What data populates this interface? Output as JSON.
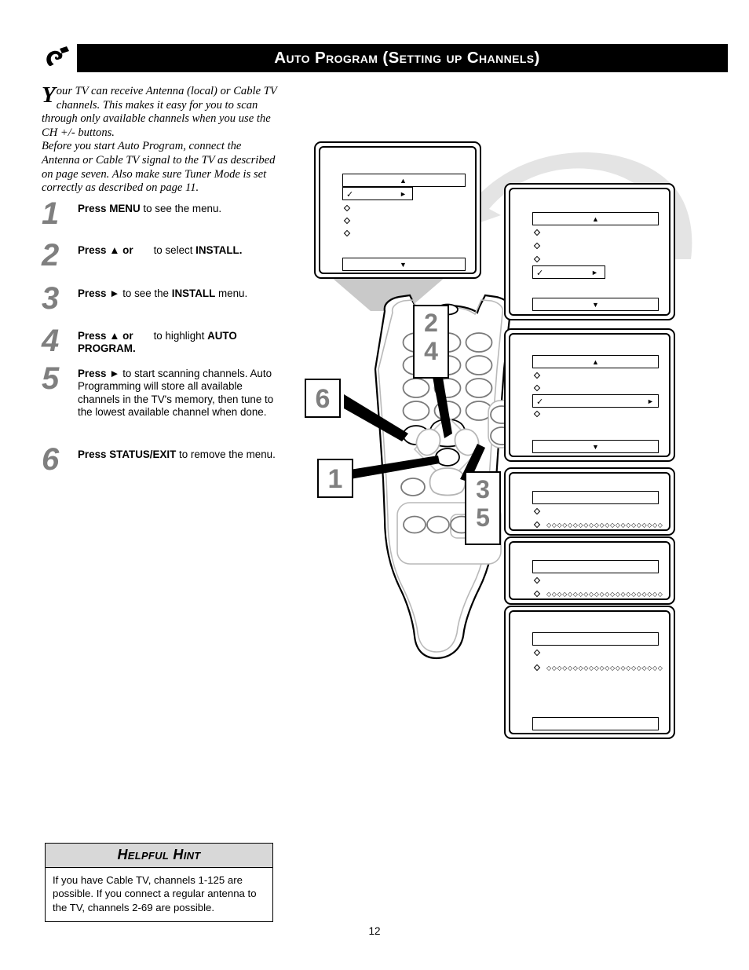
{
  "header": {
    "logo_name": "philips-swoosh-logo",
    "title": "Auto Program (Setting up Channels)"
  },
  "intro": {
    "dropcap": "Y",
    "paragraph1": "our TV can receive Antenna (local) or Cable TV channels. This makes it easy for you to scan through only available channels when you use the CH +/- buttons.",
    "paragraph2": "Before you start Auto Program, connect the Antenna or Cable TV signal to the TV as described on page seven. Also make sure Tuner Mode is set correctly as described on page 11."
  },
  "steps": [
    {
      "number": "1",
      "parts": [
        {
          "text": "Press ",
          "bold": true
        },
        {
          "text": "MENU",
          "bold": true
        },
        {
          "text": " to see the menu.",
          "bold": false
        }
      ],
      "plain": "Press MENU to see the menu."
    },
    {
      "number": "2",
      "plain": "Press ▲ or    to select INSTALL."
    },
    {
      "number": "3",
      "plain": "Press ► to see the INSTALL menu."
    },
    {
      "number": "4",
      "plain": "Press ▲ or    to highlight AUTO PROGRAM."
    },
    {
      "number": "5",
      "plain": "Press ► to start scanning channels. Auto Programming will store all available channels in the TV's memory, then tune to the lowest available channel when done."
    },
    {
      "number": "6",
      "plain": "Press STATUS/EXIT to remove the menu."
    }
  ],
  "step_text": {
    "s1_press": "Press ",
    "s1_key": "MENU",
    "s1_rest": " to see the menu.",
    "s2_press": "Press ▲ or",
    "s2_mid": "to select ",
    "s2_key": "INSTALL.",
    "s3_press": "Press ►",
    "s3_mid": " to see the ",
    "s3_key": "INSTALL",
    "s3_rest": " menu.",
    "s4_press": "Press ▲ or",
    "s4_mid": "to highlight ",
    "s4_key": "AUTO PROGRAM",
    "s4_rest": ".",
    "s5_press": "Press ►",
    "s5_rest": " to start scanning channels. Auto Programming will store all available channels in the TV's memory, then tune to the lowest available channel when done.",
    "s6_press": "Press ",
    "s6_key": "STATUS/EXIT",
    "s6_rest": " to remove the menu."
  },
  "hint": {
    "heading": "Helpful Hint",
    "body": "If you have Cable TV, channels 1-125 are possible. If you connect a regular antenna to the TV, channels 2-69 are possible."
  },
  "page_number": "12",
  "illustration": {
    "remote_callouts": [
      {
        "label": "6",
        "target": "status-exit-button"
      },
      {
        "label": "2",
        "target": "up-arrow-button"
      },
      {
        "label": "4",
        "target": "up-arrow-button"
      },
      {
        "label": "1",
        "target": "menu-button"
      },
      {
        "label": "3",
        "target": "right-arrow-button"
      },
      {
        "label": "5",
        "target": "right-arrow-button"
      }
    ],
    "callout_top_right": "2",
    "callout_top_right2": "4",
    "callout_left": "6",
    "callout_center": "1",
    "callout_bottom_right": "3",
    "callout_bottom_right2": "5",
    "tv_screens": [
      {
        "name": "main-menu-screen",
        "rows": 5,
        "selected_index": 1,
        "arrow_up": "▲",
        "arrow_down": "▼"
      },
      {
        "name": "install-menu-screen",
        "rows": 4,
        "selected_index": 3,
        "arrow_up": "▲",
        "arrow_down": "▼"
      },
      {
        "name": "auto-program-highlight-screen",
        "rows": 4,
        "selected_index": 2,
        "arrow_up": "▲",
        "arrow_down": "▼"
      },
      {
        "name": "scanning-screen-1",
        "progress_dots": 22
      },
      {
        "name": "scanning-screen-2",
        "progress_dots": 22
      },
      {
        "name": "scanning-complete-screen",
        "progress_dots": 22
      }
    ],
    "ir_beam_name": "ir-signal-beam",
    "curved_arrow_name": "flow-arrow"
  },
  "colors": {
    "step_number_gray": "#7f7f7f",
    "header_black": "#000000",
    "hint_header_gray": "#d8d8d8",
    "arrow_gray": "#e2e2e2",
    "beam_gray": "#c8c8c8"
  }
}
